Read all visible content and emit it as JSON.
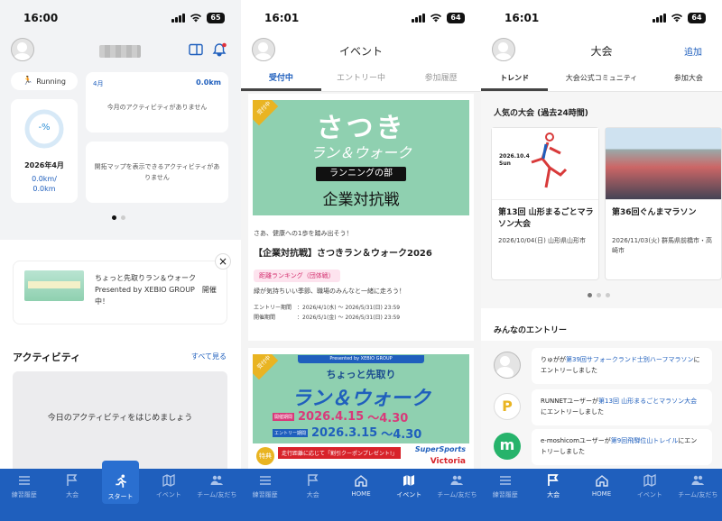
{
  "screens": [
    {
      "status": {
        "time": "16:00",
        "battery": "65"
      },
      "running_chip": "Running",
      "month_card": {
        "month": "4月",
        "distance": "0.0km",
        "empty": "今月のアクティビティがありません"
      },
      "map_card": {
        "empty": "開拓マップを表示できるアクティビティがありません"
      },
      "progress": {
        "label": "-%",
        "fraction": 0.0,
        "date": "2026年4月",
        "km": "0.0km/",
        "km_total": "0.0km"
      },
      "promo": {
        "text": "ちょっと先取りラン＆ウォーク Presented by XEBIO GROUP　開催中！"
      },
      "activity": {
        "title": "アクティビティ",
        "see_all": "すべて見る",
        "empty": "今日のアクティビティをはじめましょう"
      },
      "tabs": [
        {
          "label": "練習履歴",
          "icon": "list-icon"
        },
        {
          "label": "大会",
          "icon": "flag-icon"
        },
        {
          "label": "スタート",
          "icon": "runner-icon"
        },
        {
          "label": "イベント",
          "icon": "map-icon"
        },
        {
          "label": "チーム/友だち",
          "icon": "people-icon"
        }
      ]
    },
    {
      "status": {
        "time": "16:01",
        "battery": "64"
      },
      "title": "イベント",
      "segments": [
        "受付中",
        "エントリー中",
        "参加履歴"
      ],
      "event": {
        "banner_line1": "さつき",
        "banner_line2": "ラン＆ウォーク",
        "banner_line3": "ランニングの部",
        "banner_line4": "企業対抗戦",
        "banner_badge": "受付中",
        "lead": "さあ、健康への1歩を踏み出そう！",
        "title": "【企業対抗戦】さつきラン＆ウォーク2026",
        "tag": "距離ランキング（団体戦）",
        "desc": "緑が気持ちいい季節、職場のみんなと一緒に走ろう！",
        "entry_label": "エントリー期間",
        "entry_value": "：2026/4/1(水) 〜 2026/5/31(日) 23:59",
        "period_label": "開催期間",
        "period_value": "：2026/5/1(金) 〜 2026/5/31(日) 23:59"
      },
      "event2": {
        "presented": "Presented by XEBIO GROUP",
        "line1": "ちょっと先取り",
        "line2": "ラン＆ウォーク",
        "date1_tag": "開催期間",
        "date1": "2026.4.15",
        "date1_end": "〜4.30",
        "date2_tag": "エントリー期間",
        "date2": "2026.3.15",
        "date2_end": "〜4.30",
        "badge": "受付中",
        "coupon": "走行距離に応じて「割引クーポンプレゼント!」",
        "special": "特典",
        "brand1": "SuperSports",
        "brand2": "Victoria"
      },
      "tabs": [
        {
          "label": "練習履歴",
          "icon": "list-icon"
        },
        {
          "label": "大会",
          "icon": "flag-icon"
        },
        {
          "label": "HOME",
          "icon": "home-icon"
        },
        {
          "label": "イベント",
          "icon": "map-icon"
        },
        {
          "label": "チーム/友だち",
          "icon": "people-icon"
        }
      ]
    },
    {
      "status": {
        "time": "16:01",
        "battery": "64"
      },
      "title": "大会",
      "add": "追加",
      "segments": [
        "トレンド",
        "大会公式コミュニティ",
        "参加大会"
      ],
      "popular": "人気の大会 (過去24時間)",
      "races": [
        {
          "name": "第13回 山形まるごとマラソン大会",
          "date": "2026/10/04(日)",
          "place": "山形県山形市",
          "poster_date": "2026.10.4 Sun"
        },
        {
          "name": "第36回ぐんまマラソン",
          "date": "2026/11/03(火)",
          "place": "群馬県前橋市・高崎市"
        }
      ],
      "entries_title": "みんなのエントリー",
      "entries": [
        {
          "user": "りゅが",
          "mid": "が",
          "race": "第39回サフォークランド士別ハーフマラソン",
          "tail": "にエントリーしました",
          "avatar": "default"
        },
        {
          "user": "RUNNETユーザー",
          "mid": "が",
          "race": "第13回 山形まるごとマラソン大会",
          "tail": "にエントリーしました",
          "avatar": "P"
        },
        {
          "user": "e-moshicomユーザー",
          "mid": "が",
          "race": "第9回飛騨位山トレイル",
          "tail": "にエントリーしました",
          "avatar": "m"
        }
      ],
      "tabs": [
        {
          "label": "練習履歴",
          "icon": "list-icon"
        },
        {
          "label": "大会",
          "icon": "flag-icon"
        },
        {
          "label": "HOME",
          "icon": "home-icon"
        },
        {
          "label": "イベント",
          "icon": "map-icon"
        },
        {
          "label": "チーム/友だち",
          "icon": "people-icon"
        }
      ]
    }
  ],
  "colors": {
    "primary": "#1f5fbd",
    "accent_pink": "#d4306f",
    "event_green": "#8fd0b0",
    "tabbar": "#1f5fbd"
  }
}
